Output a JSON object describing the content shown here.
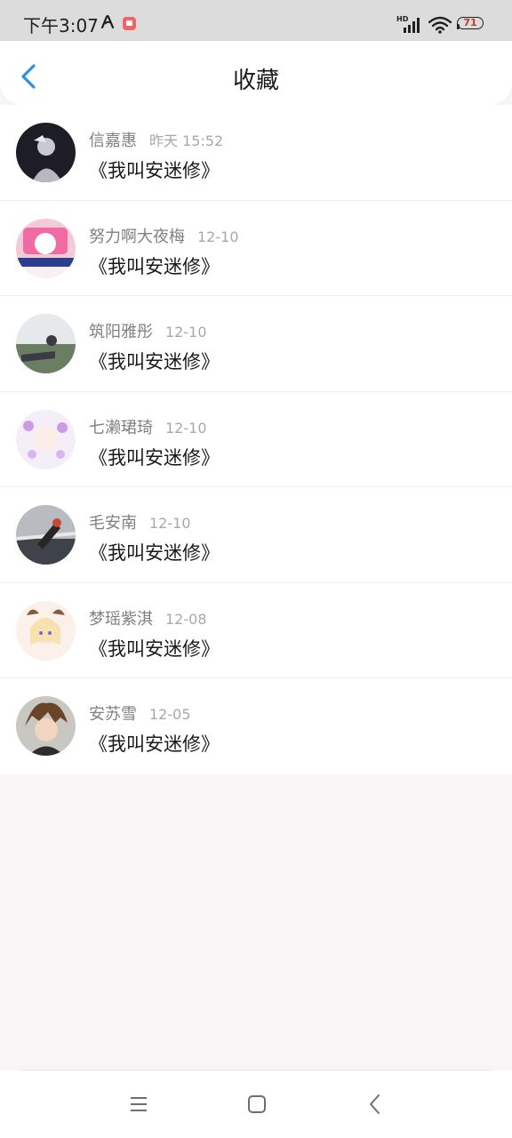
{
  "status_bar": {
    "time": "下午3:07",
    "battery": "71"
  },
  "header": {
    "title": "收藏"
  },
  "items": [
    {
      "name": "信嘉惠",
      "time": "昨天 15:52",
      "title": "《我叫安迷修》"
    },
    {
      "name": "努力啊大夜梅",
      "time": "12-10",
      "title": "《我叫安迷修》"
    },
    {
      "name": "筑阳雅彤",
      "time": "12-10",
      "title": "《我叫安迷修》"
    },
    {
      "name": "七濑珺琦",
      "time": "12-10",
      "title": "《我叫安迷修》"
    },
    {
      "name": "毛安南",
      "time": "12-10",
      "title": "《我叫安迷修》"
    },
    {
      "name": "梦瑶紫淇",
      "time": "12-08",
      "title": "《我叫安迷修》"
    },
    {
      "name": "安苏雪",
      "time": "12-05",
      "title": "《我叫安迷修》"
    }
  ],
  "colors": {
    "accent": "#2f8ff0",
    "background": "#f7f5f5",
    "name_text": "#808080",
    "time_text": "#a8a8a8"
  },
  "icons": {
    "back": "chevron-left-icon",
    "nav_menu": "menu-icon",
    "nav_home": "home-square-icon",
    "nav_back": "back-triangle-icon"
  }
}
